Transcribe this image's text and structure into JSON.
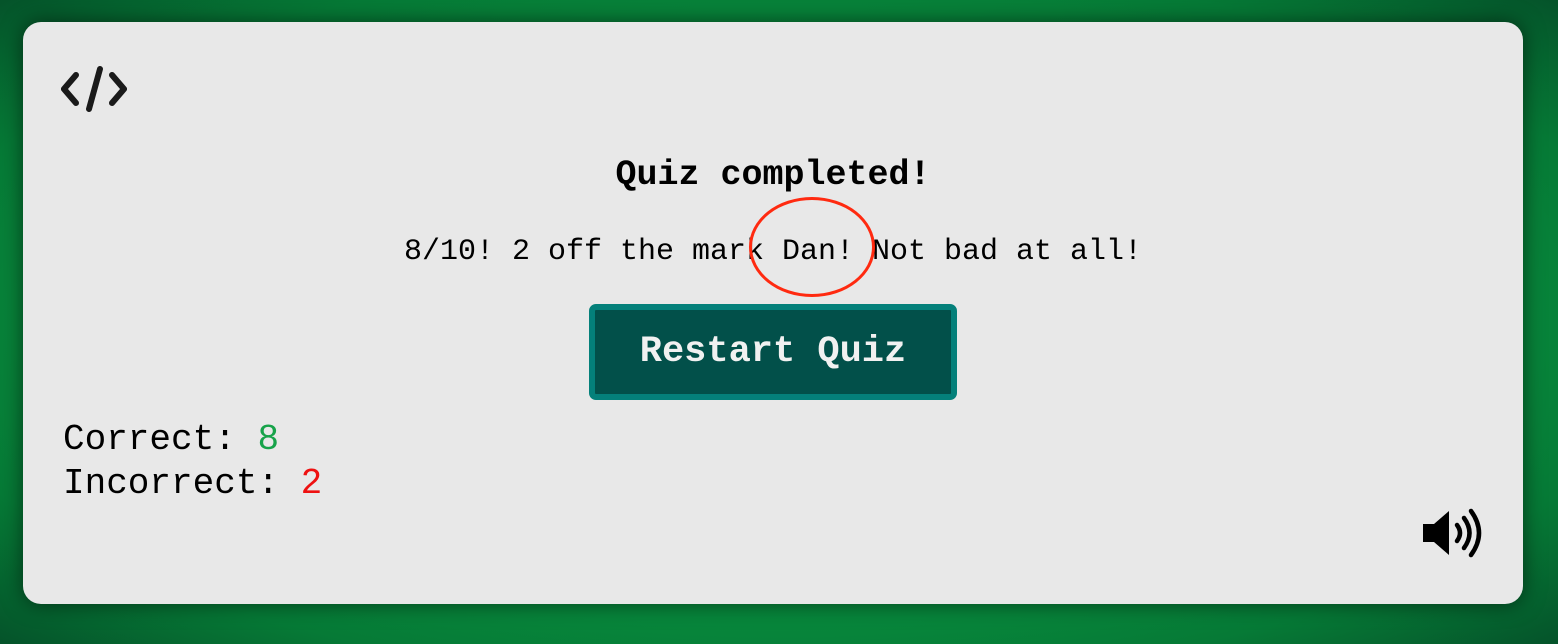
{
  "logo": {
    "icon": "code-icon",
    "text": "</>"
  },
  "result": {
    "title": "Quiz completed!",
    "message": "8/10! 2 off the mark Dan! Not bad at all!"
  },
  "restart": {
    "label": "Restart Quiz"
  },
  "stats": {
    "correct_label": "Correct: ",
    "correct_value": "8",
    "incorrect_label": "Incorrect: ",
    "incorrect_value": "2"
  },
  "sound": {
    "icon": "volume-icon"
  },
  "colors": {
    "page_background": "#08903f",
    "card_background": "#e8e8e8",
    "button_background": "#02504a",
    "button_border": "#04807a",
    "button_text": "#f1f1f1",
    "correct": "#17a34a",
    "incorrect": "#ee1111",
    "annotation_circle": "#ff2a10"
  }
}
